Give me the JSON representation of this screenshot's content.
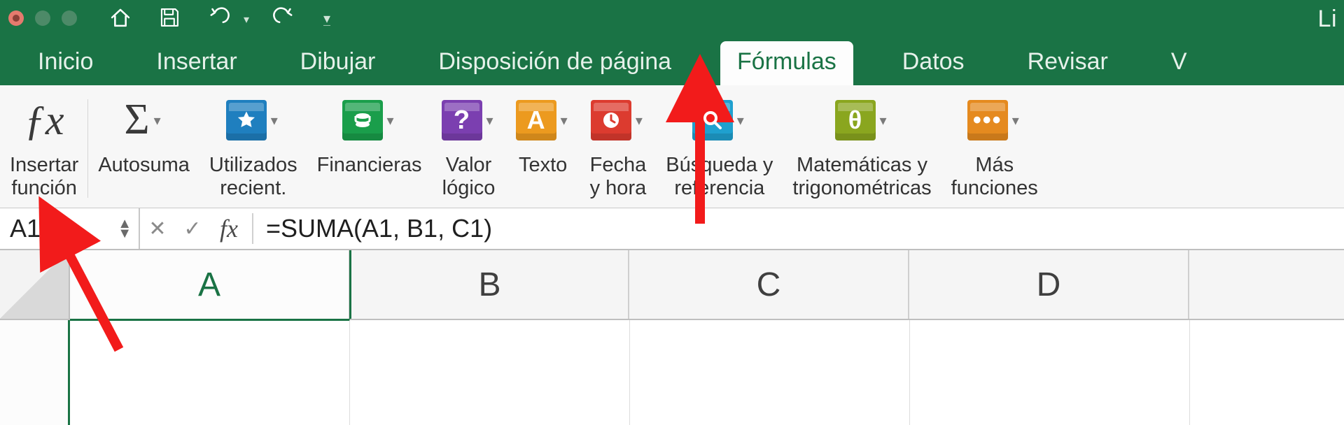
{
  "title_right_fragment": "Li",
  "tabs": {
    "inicio": "Inicio",
    "insertar": "Insertar",
    "dibujar": "Dibujar",
    "disposicion": "Disposición de página",
    "formulas": "Fórmulas",
    "datos": "Datos",
    "revisar": "Revisar",
    "vista_fragment": "V"
  },
  "ribbon": {
    "insertar_funcion": "Insertar\nfunción",
    "autosuma": "Autosuma",
    "utilizados": "Utilizados\nrecient.",
    "financieras": "Financieras",
    "valor_logico": "Valor\nlógico",
    "texto": "Texto",
    "fecha": "Fecha\ny hora",
    "busqueda": "Búsqueda y\nreferencia",
    "matematicas": "Matemáticas y\ntrigonométricas",
    "mas": "Más\nfunciones"
  },
  "formula_bar": {
    "cell_ref": "A1",
    "fx": "fx",
    "value": "=SUMA(A1, B1, C1)"
  },
  "columns": {
    "a": "A",
    "b": "B",
    "c": "C",
    "d": "D"
  }
}
